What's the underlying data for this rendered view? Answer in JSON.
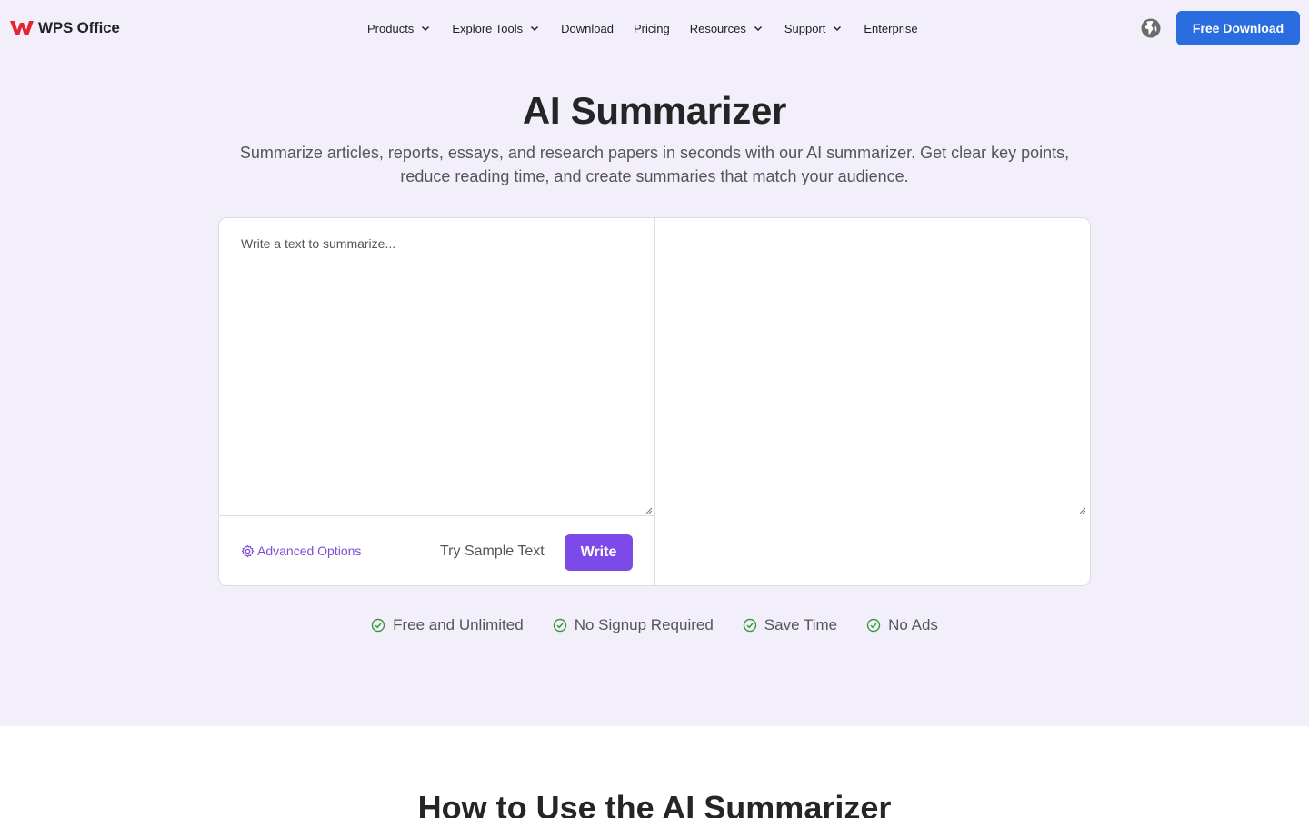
{
  "header": {
    "logo_text": "WPS Office",
    "nav": [
      {
        "label": "Products",
        "has_dropdown": true
      },
      {
        "label": "Explore Tools",
        "has_dropdown": true
      },
      {
        "label": "Download",
        "has_dropdown": false
      },
      {
        "label": "Pricing",
        "has_dropdown": false
      },
      {
        "label": "Resources",
        "has_dropdown": true
      },
      {
        "label": "Support",
        "has_dropdown": true
      },
      {
        "label": "Enterprise",
        "has_dropdown": false
      }
    ],
    "globe_icon": "globe-icon",
    "cta_label": "Free Download"
  },
  "hero": {
    "title": "AI Summarizer",
    "subtitle": "Summarize articles, reports, essays, and research papers in seconds with our AI summarizer. Get clear key points, reduce reading time, and create summaries that match your audience."
  },
  "tool": {
    "input_placeholder": "Write a text to summarize...",
    "input_value": "",
    "output_value": "",
    "advanced_label": "Advanced Options",
    "sample_label": "Try Sample Text",
    "write_label": "Write"
  },
  "features": [
    {
      "label": "Free and Unlimited",
      "icon": "check-circle-icon"
    },
    {
      "label": "No Signup Required",
      "icon": "check-circle-icon"
    },
    {
      "label": "Save Time",
      "icon": "check-circle-icon"
    },
    {
      "label": "No Ads",
      "icon": "check-circle-icon"
    }
  ],
  "next_section": {
    "title": "How to Use the AI Summarizer"
  },
  "colors": {
    "hero_bg": "#f2effb",
    "primary_blue": "#2a6de0",
    "accent_purple": "#7c4ae8",
    "check_green": "#3a9a3a",
    "logo_red": "#e3262e"
  }
}
